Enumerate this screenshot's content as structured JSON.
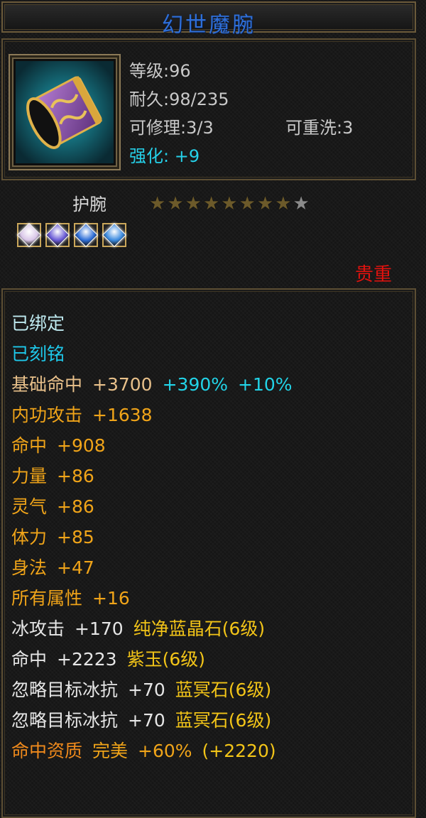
{
  "item": {
    "name": "幻世魔腕",
    "level": "等级:96",
    "durability": "耐久:98/235",
    "repairable": "可修理:3/3",
    "rewashable": "可重洗:3",
    "enhance": "强化: +9",
    "type": "护腕",
    "stars": {
      "filled": 8,
      "total": 9
    },
    "rarity": "贵重",
    "icon": "bracer-icon"
  },
  "gems": [
    {
      "icon": "pink-gem-icon",
      "color": "#d9c6e8"
    },
    {
      "icon": "violet-gem-icon",
      "color": "#6a5bd6"
    },
    {
      "icon": "blue-gem-icon",
      "color": "#2f6fd8"
    },
    {
      "icon": "blue-gem-icon",
      "color": "#3c8be0"
    }
  ],
  "attributes": [
    {
      "parts": [
        {
          "text": "已绑定",
          "color": "#bfeaf0"
        }
      ]
    },
    {
      "parts": [
        {
          "text": "已刻铭",
          "color": "#1ec8ea"
        }
      ]
    },
    {
      "parts": [
        {
          "text": "基础命中",
          "color": "#e8c08a"
        },
        {
          "text": "+3700",
          "color": "#e8c08a"
        },
        {
          "text": "+390%",
          "color": "#22d4e8"
        },
        {
          "text": "+10%",
          "color": "#22d4e8"
        }
      ]
    },
    {
      "parts": [
        {
          "text": "内功攻击",
          "color": "#f0a419"
        },
        {
          "text": "+1638",
          "color": "#f0a419"
        }
      ]
    },
    {
      "parts": [
        {
          "text": "命中",
          "color": "#f0a419"
        },
        {
          "text": "+908",
          "color": "#f0a419"
        }
      ]
    },
    {
      "parts": [
        {
          "text": "力量",
          "color": "#f0a419"
        },
        {
          "text": "+86",
          "color": "#f0a419"
        }
      ]
    },
    {
      "parts": [
        {
          "text": "灵气",
          "color": "#f0a419"
        },
        {
          "text": "+86",
          "color": "#f0a419"
        }
      ]
    },
    {
      "parts": [
        {
          "text": "体力",
          "color": "#f0a419"
        },
        {
          "text": "+85",
          "color": "#f0a419"
        }
      ]
    },
    {
      "parts": [
        {
          "text": "身法",
          "color": "#f0a419"
        },
        {
          "text": "+47",
          "color": "#f0a419"
        }
      ]
    },
    {
      "parts": [
        {
          "text": "所有属性",
          "color": "#f0a419"
        },
        {
          "text": "+16",
          "color": "#f0a419"
        }
      ]
    },
    {
      "parts": [
        {
          "text": "冰攻击",
          "color": "#e6e6e6"
        },
        {
          "text": "+170",
          "color": "#e6e6e6"
        },
        {
          "text": "纯净蓝晶石(6级)",
          "color": "#f2c418"
        }
      ]
    },
    {
      "parts": [
        {
          "text": "命中",
          "color": "#e6e6e6"
        },
        {
          "text": "+2223",
          "color": "#e6e6e6"
        },
        {
          "text": "紫玉(6级)",
          "color": "#f2c418"
        }
      ]
    },
    {
      "parts": [
        {
          "text": "忽略目标冰抗",
          "color": "#e6e6e6"
        },
        {
          "text": "+70",
          "color": "#e6e6e6"
        },
        {
          "text": "蓝冥石(6级)",
          "color": "#f2c418"
        }
      ]
    },
    {
      "parts": [
        {
          "text": "忽略目标冰抗",
          "color": "#e6e6e6"
        },
        {
          "text": "+70",
          "color": "#e6e6e6"
        },
        {
          "text": "蓝冥石(6级)",
          "color": "#f2c418"
        }
      ]
    },
    {
      "parts": [
        {
          "text": "命中资质",
          "color": "#f08a1c"
        },
        {
          "text": "完美",
          "color": "#f0a419"
        },
        {
          "text": "+60%",
          "color": "#f0a419"
        },
        {
          "text": "(+2220)",
          "color": "#f2c418"
        }
      ]
    }
  ]
}
